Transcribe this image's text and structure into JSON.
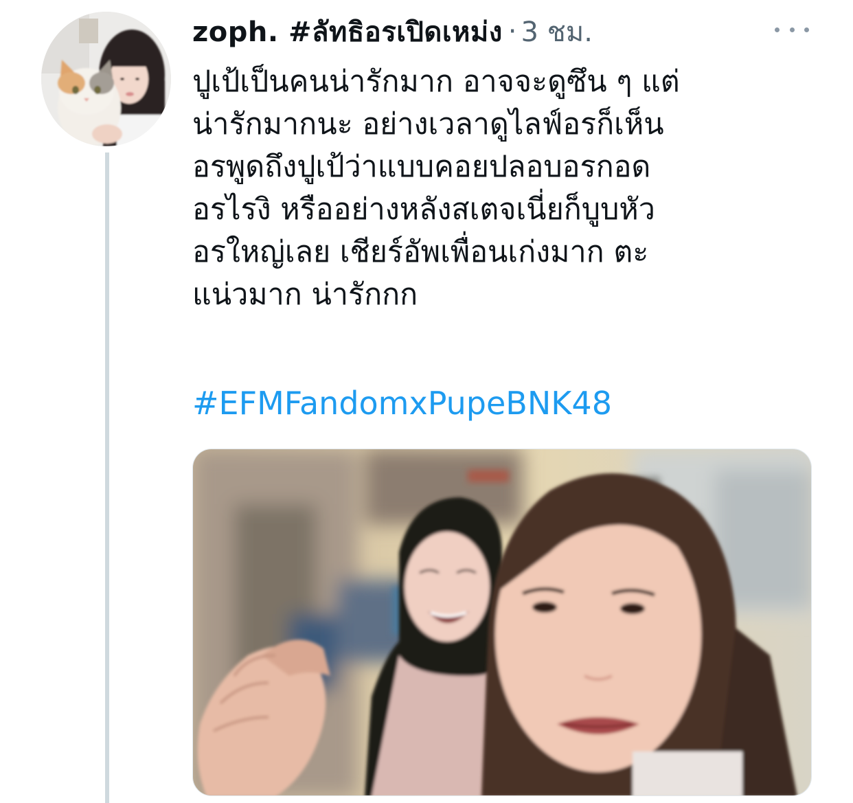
{
  "tweet": {
    "display_name": "zoph. #ลัทธิอรเปิดเหม่ง",
    "separator": "·",
    "timestamp": "3 ชม.",
    "text_lines": [
      "ปูเป้เป็นคนน่ารักมาก อาจจะดูซึน ๆ แต่",
      "น่ารักมากนะ อย่างเวลาดูไลฟ์อรก็เห็น",
      "อรพูดถึงปูเป้ว่าแบบคอยปลอบอรกอด",
      "อรไรงิ หรืออย่างหลังสเตจเนี่ยก็บูบหัว",
      "อรใหญ่เลย เชียร์อัพเพื่อนเก่งมาก ตะ",
      "แน่วมาก น่ารักกก"
    ],
    "hashtag": "#EFMFandomxPupeBNK48"
  },
  "icons": {
    "more": "more-horizontal-icon",
    "avatar": "profile-photo-girl-with-cat",
    "media": "photo-two-girls-crying"
  },
  "colors": {
    "text": "#0f1419",
    "secondary": "#536471",
    "link": "#1d9bf0",
    "thread_line": "#cfd9de"
  }
}
